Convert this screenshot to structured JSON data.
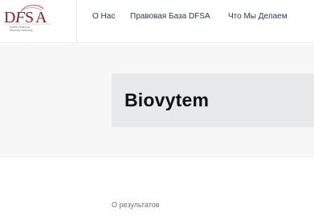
{
  "header": {
    "logo": {
      "text": "DFSA",
      "subtitle_lines": [
        "Dubai Financial",
        "Services Authority"
      ],
      "brand_color": "#8b1e2d"
    },
    "nav": [
      {
        "label": "О Нас"
      },
      {
        "label": "Правовая База DFSA"
      },
      {
        "label": "Что Мы Делаем"
      }
    ]
  },
  "hero": {
    "title": "Biovytem"
  },
  "results": {
    "text": "О результатов"
  }
}
